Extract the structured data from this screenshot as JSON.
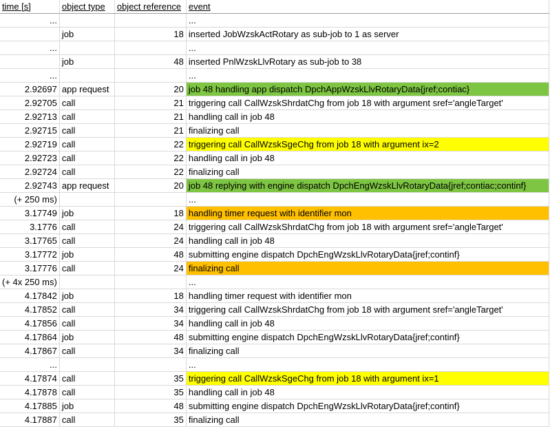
{
  "headers": [
    "time [s]",
    "object type",
    "object reference",
    "event"
  ],
  "colors": {
    "green": "#7dc542",
    "yellow": "#ffff00",
    "orange": "#ffc000"
  },
  "rows": [
    {
      "time": "...",
      "type": "",
      "ref": "",
      "event": "...",
      "hl": ""
    },
    {
      "time": "",
      "type": "job",
      "ref": "18",
      "event": "inserted JobWzskActRotary as sub-job to 1 as server",
      "hl": ""
    },
    {
      "time": "...",
      "type": "",
      "ref": "",
      "event": "...",
      "hl": ""
    },
    {
      "time": "",
      "type": "job",
      "ref": "48",
      "event": "inserted PnlWzskLlvRotary as sub-job to 38",
      "hl": ""
    },
    {
      "time": "...",
      "type": "",
      "ref": "",
      "event": "...",
      "hl": ""
    },
    {
      "time": "2.92697",
      "type": "app request",
      "ref": "20",
      "event": "job 48 handling app dispatch DpchAppWzskLlvRotaryData{jref;contiac}",
      "hl": "green"
    },
    {
      "time": "2.92705",
      "type": "call",
      "ref": "21",
      "event": "triggering call CallWzskShrdatChg from job 18 with argument sref='angleTarget'",
      "hl": ""
    },
    {
      "time": "2.92713",
      "type": "call",
      "ref": "21",
      "event": "handling call in job 48",
      "hl": ""
    },
    {
      "time": "2.92715",
      "type": "call",
      "ref": "21",
      "event": "finalizing call",
      "hl": ""
    },
    {
      "time": "2.92719",
      "type": "call",
      "ref": "22",
      "event": "triggering call CallWzskSgeChg from job 18 with argument ix=2",
      "hl": "yellow"
    },
    {
      "time": "2.92723",
      "type": "call",
      "ref": "22",
      "event": "handling call in job 48",
      "hl": ""
    },
    {
      "time": "2.92724",
      "type": "call",
      "ref": "22",
      "event": "finalizing call",
      "hl": ""
    },
    {
      "time": "2.92743",
      "type": "app request",
      "ref": "20",
      "event": "job 48 replying with engine dispatch DpchEngWzskLlvRotaryData{jref;contiac;continf}",
      "hl": "green"
    },
    {
      "time": "(+ 250 ms)",
      "type": "",
      "ref": "",
      "event": "...",
      "hl": ""
    },
    {
      "time": "3.17749",
      "type": "job",
      "ref": "18",
      "event": "handling timer request with identifier mon",
      "hl": "orange"
    },
    {
      "time": "3.1776",
      "type": "call",
      "ref": "24",
      "event": "triggering call CallWzskShrdatChg from job 18 with argument sref='angleTarget'",
      "hl": ""
    },
    {
      "time": "3.17765",
      "type": "call",
      "ref": "24",
      "event": "handling call in job 48",
      "hl": ""
    },
    {
      "time": "3.17772",
      "type": "job",
      "ref": "48",
      "event": "submitting engine dispatch DpchEngWzskLlvRotaryData{jref;continf}",
      "hl": ""
    },
    {
      "time": "3.17776",
      "type": "call",
      "ref": "24",
      "event": "finalizing call",
      "hl": "orange"
    },
    {
      "time": "(+ 4x 250 ms)",
      "type": "",
      "ref": "",
      "event": "...",
      "hl": ""
    },
    {
      "time": "4.17842",
      "type": "job",
      "ref": "18",
      "event": "handling timer request with identifier mon",
      "hl": ""
    },
    {
      "time": "4.17852",
      "type": "call",
      "ref": "34",
      "event": "triggering call CallWzskShrdatChg from job 18 with argument sref='angleTarget'",
      "hl": ""
    },
    {
      "time": "4.17856",
      "type": "call",
      "ref": "34",
      "event": "handling call in job 48",
      "hl": ""
    },
    {
      "time": "4.17864",
      "type": "job",
      "ref": "48",
      "event": "submitting engine dispatch DpchEngWzskLlvRotaryData{jref;continf}",
      "hl": ""
    },
    {
      "time": "4.17867",
      "type": "call",
      "ref": "34",
      "event": "finalizing call",
      "hl": ""
    },
    {
      "time": "...",
      "type": "",
      "ref": "",
      "event": "...",
      "hl": ""
    },
    {
      "time": "4.17874",
      "type": "call",
      "ref": "35",
      "event": "triggering call CallWzskSgeChg from job 18 with argument ix=1",
      "hl": "yellow"
    },
    {
      "time": "4.17878",
      "type": "call",
      "ref": "35",
      "event": "handling call in job 48",
      "hl": ""
    },
    {
      "time": "4.17885",
      "type": "job",
      "ref": "48",
      "event": "submitting engine dispatch DpchEngWzskLlvRotaryData{jref;continf}",
      "hl": ""
    },
    {
      "time": "4.17887",
      "type": "call",
      "ref": "35",
      "event": "finalizing call",
      "hl": ""
    }
  ]
}
